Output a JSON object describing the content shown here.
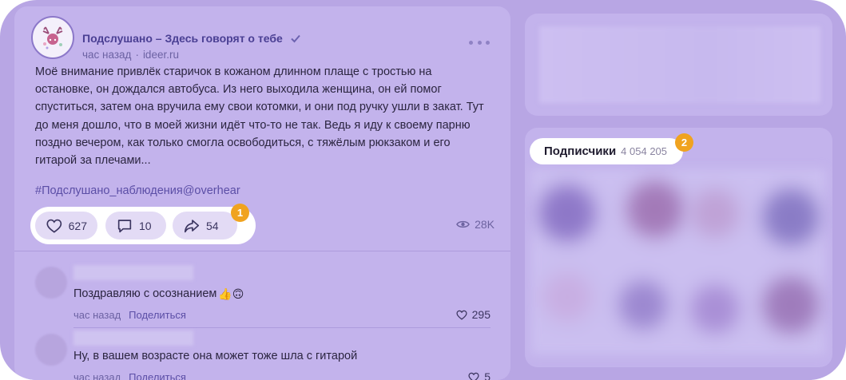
{
  "post": {
    "group_name": "Подслушано – Здесь говорят о тебе",
    "time": "час назад",
    "source": "ideer.ru",
    "text": "Моё внимание привлёк старичок в кожаном длинном плаще с тростью на остановке, он дождался автобуса. Из него выходила женщина, он ей помог спуститься, затем она вручила ему свои котомки, и они под ручку ушли в закат. Тут до меня дошло, что в моей жизни идёт что-то не так. Ведь я иду к своему парню поздно вечером, как только смогла освободиться, с тяжёлым рюкзаком и его гитарой за плечами...",
    "hashtag": "#Подслушано_наблюдения@overhear",
    "likes": "627",
    "comments": "10",
    "shares": "54",
    "views": "28K",
    "badge": "1"
  },
  "comments": [
    {
      "text": "Поздравляю с осознанием",
      "emoji": "👍🙃",
      "time": "час назад",
      "share_label": "Поделиться",
      "likes": "295"
    },
    {
      "text": "Ну, в вашем возрасте она может тоже шла с гитарой",
      "time": "час назад",
      "share_label": "Поделиться",
      "likes": "5"
    }
  ],
  "sidebar": {
    "subscribers_label": "Подписчики",
    "subscribers_count": "4 054 205",
    "badge": "2"
  },
  "colors": {
    "background": "#b8a6e4",
    "card": "#c3b3ec",
    "accent": "#4a3f93",
    "badge": "#f0a31f"
  }
}
